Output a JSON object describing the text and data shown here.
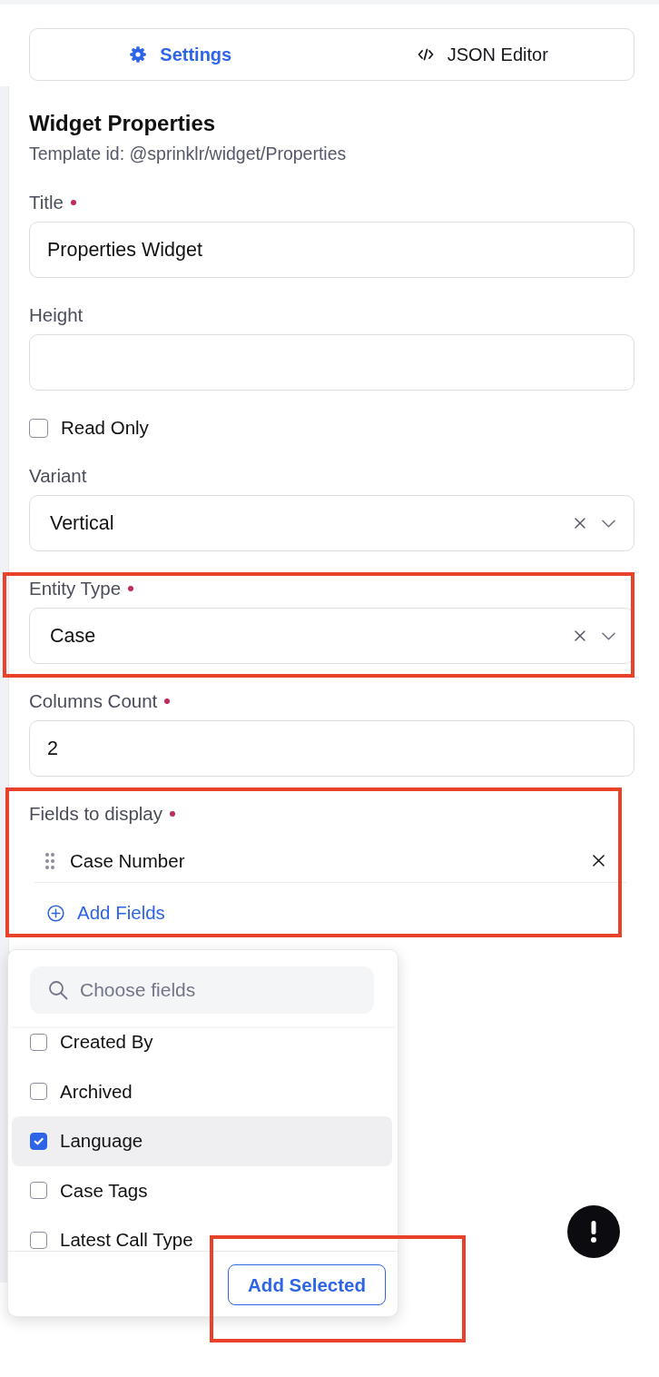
{
  "tabs": [
    {
      "label": "Settings",
      "selected": true
    },
    {
      "label": "JSON Editor",
      "selected": false
    }
  ],
  "heading": {
    "title": "Widget Properties",
    "template_id": "Template id: @sprinklr/widget/Properties"
  },
  "form": [
    {
      "kind": "text",
      "label": "Title",
      "required": true,
      "value": "Properties Widget"
    },
    {
      "kind": "text",
      "label": "Height",
      "required": false
    },
    {
      "kind": "checkbox",
      "label": "Read Only",
      "checked": false
    },
    {
      "kind": "select",
      "label": "Variant",
      "required": false,
      "value": "Vertical"
    },
    {
      "kind": "select",
      "label": "Entity Type",
      "required": true,
      "value": "Case",
      "annotated": true
    },
    {
      "kind": "text",
      "label": "Columns Count",
      "required": true,
      "value": "2"
    },
    {
      "kind": "list",
      "label": "Fields to display",
      "required": true,
      "items": [
        {
          "label": "Case Number"
        }
      ],
      "add_label": "Add Fields",
      "annotated": true
    }
  ],
  "field_picker": {
    "placeholder": "Choose fields",
    "options": [
      {
        "label": "Created By",
        "checked": false,
        "focused": false
      },
      {
        "label": "Archived",
        "checked": false,
        "focused": false
      },
      {
        "label": "Language",
        "checked": true,
        "focused": true
      },
      {
        "label": "Case Tags",
        "checked": false,
        "focused": false
      },
      {
        "label": "Latest Call Type",
        "checked": false,
        "focused": false
      }
    ],
    "button": {
      "label": "Add Selected",
      "annotated": true
    }
  }
}
